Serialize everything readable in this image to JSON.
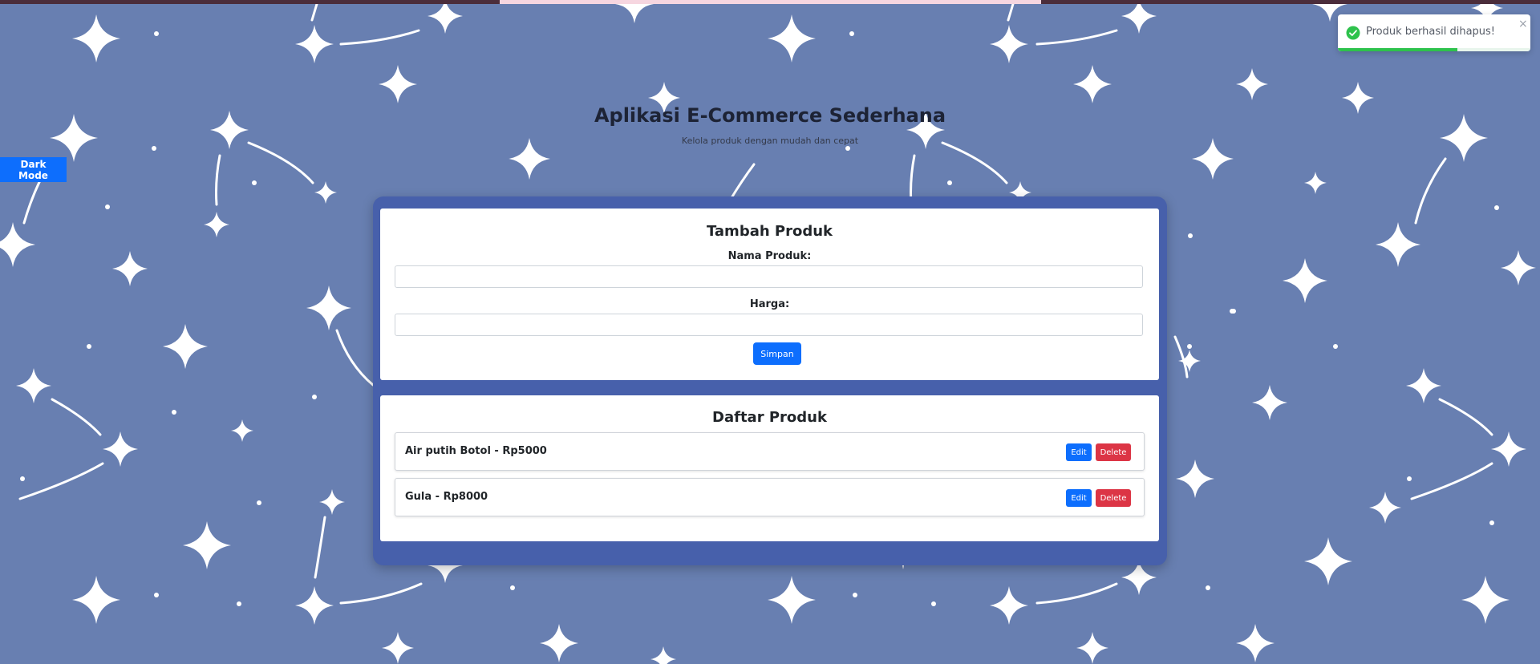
{
  "header": {
    "title": "Aplikasi E-Commerce Sederhana",
    "subtitle": "Kelola produk dengan mudah dan cepat"
  },
  "theme_toggle": {
    "label": "Dark Mode"
  },
  "form": {
    "title": "Tambah Produk",
    "name_label": "Nama Produk:",
    "name_value": "",
    "price_label": "Harga:",
    "price_value": "",
    "save_label": "Simpan"
  },
  "product_list": {
    "title": "Daftar Produk",
    "items": [
      {
        "label": "Air putih Botol - Rp5000",
        "edit_label": "Edit",
        "delete_label": "Delete"
      },
      {
        "label": "Gula - Rp8000",
        "edit_label": "Edit",
        "delete_label": "Delete"
      }
    ]
  },
  "toast": {
    "message": "Produk berhasil dihapus!",
    "close_glyph": "×",
    "icon": "check-circle-icon",
    "progress": 0.62
  },
  "colors": {
    "background": "#687fb1",
    "container": "#4760ab",
    "primary": "#0d6efd",
    "danger": "#dc3545",
    "success": "#2ec24c"
  }
}
